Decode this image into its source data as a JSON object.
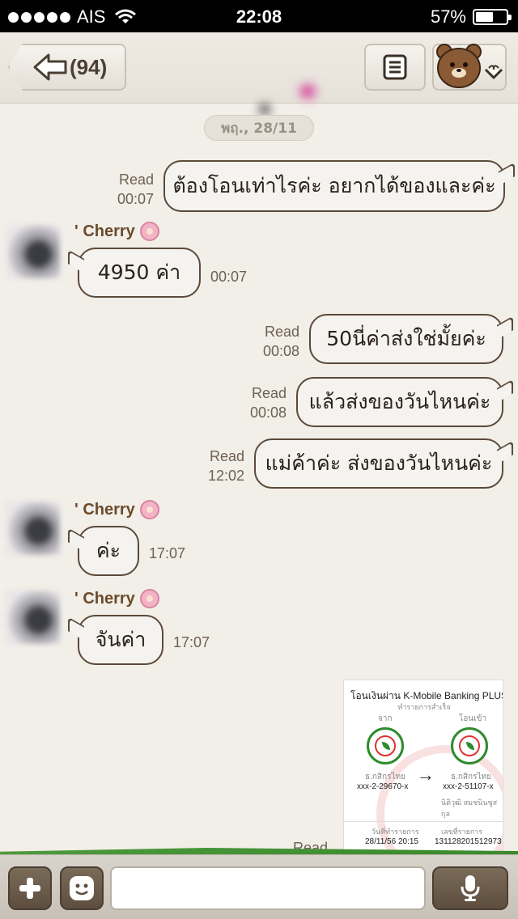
{
  "status_bar": {
    "carrier": "AIS",
    "time": "22:08",
    "battery_percent": "57%",
    "battery_level": 0.57,
    "icons": [
      "signal-dots-icon",
      "wifi-icon",
      "battery-icon"
    ]
  },
  "header": {
    "back_count": "(94)",
    "icons": [
      "back-arrow-icon",
      "menu-list-icon",
      "brown-bear-icon",
      "chevron-down-icon"
    ]
  },
  "date_label": "พฤ., 28/11",
  "messages": [
    {
      "direction": "out",
      "text": "ต้องโอนเท่าไรค่ะ อยากได้ของและค่ะ",
      "status": "Read",
      "time": "00:07"
    },
    {
      "direction": "in",
      "sender": "' Cherry",
      "text": "4950 ค่า",
      "time": "00:07"
    },
    {
      "direction": "out",
      "text": "50นี่ค่าส่งใช่มั้ยค่ะ",
      "status": "Read",
      "time": "00:08"
    },
    {
      "direction": "out",
      "text": "แล้วส่งของวันไหนค่ะ",
      "status": "Read",
      "time": "00:08"
    },
    {
      "direction": "out",
      "text": "แม่ค้าค่ะ ส่งของวันไหนค่ะ",
      "status": "Read",
      "time": "12:02"
    },
    {
      "direction": "in",
      "sender": "' Cherry",
      "text": "ค่ะ",
      "time": "17:07"
    },
    {
      "direction": "in",
      "sender": "' Cherry",
      "text": "จันค่า",
      "time": "17:07"
    }
  ],
  "receipt": {
    "title": "โอนเงินผ่าน K-Mobile Banking PLUS",
    "subtitle": "ทำรายการสำเร็จ",
    "from_label": "จาก",
    "to_label": "โอนเข้า",
    "from_bank": "ธ.กสิกรไทย",
    "to_bank": "ธ.กสิกรไทย",
    "from_account": "xxx-2-29670-x",
    "to_account": "xxx-2-51107-x",
    "to_name": "นิติวุฒิ สมชนินชูสกุล",
    "date_label": "วันที่ทำรายการ",
    "date_value": "28/11/56 20:15",
    "ref_label": "เลขที่รายการ",
    "ref_value": "131128201512973",
    "status": "Read"
  },
  "input_bar": {
    "icons": [
      "plus-icon",
      "emoji-icon",
      "microphone-icon"
    ],
    "placeholder": ""
  },
  "colors": {
    "bubble_border": "#5b4a3a",
    "background": "#f2eee8",
    "sender_name": "#6a4b2c"
  }
}
